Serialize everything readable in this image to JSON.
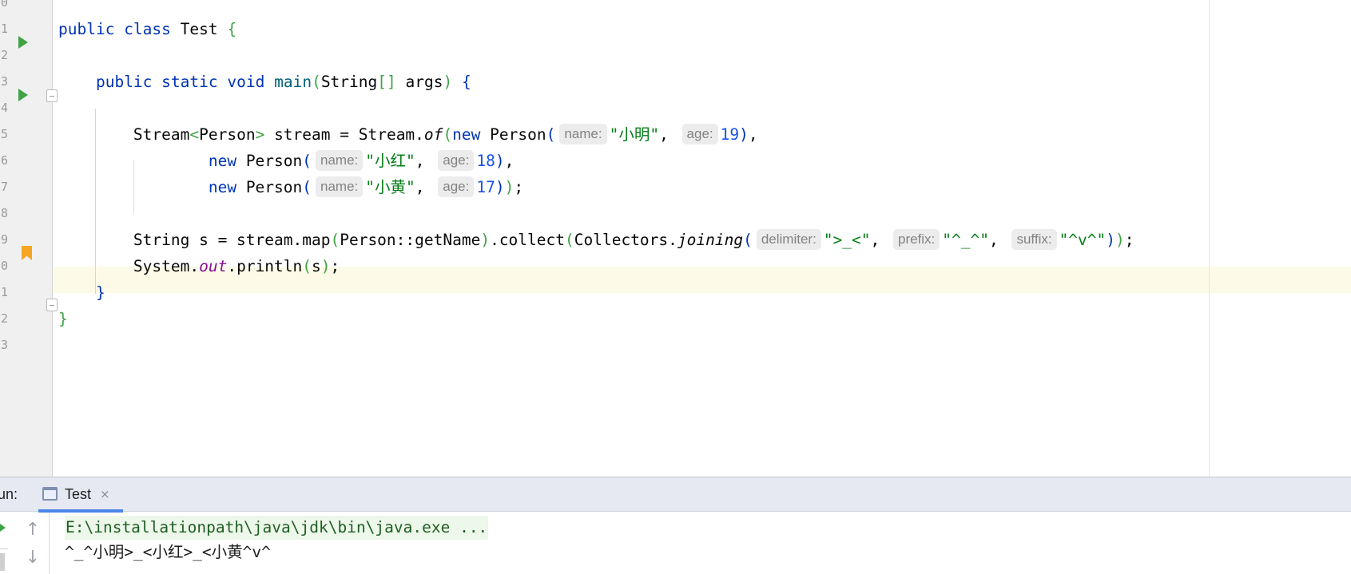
{
  "editor": {
    "file_name": "Test",
    "gutter_numbers": [
      "0",
      "1",
      "2",
      "3",
      "4",
      "5",
      "6",
      "7",
      "8",
      "9",
      "0",
      "1",
      "2",
      "3"
    ],
    "code_lines": [
      [
        {
          "t": "public",
          "c": "kw"
        },
        {
          "t": " "
        },
        {
          "t": "class",
          "c": "kw"
        },
        {
          "t": " Test "
        },
        {
          "t": "{",
          "c": "brace"
        }
      ],
      [],
      [
        {
          "t": "    "
        },
        {
          "t": "public",
          "c": "kw"
        },
        {
          "t": " "
        },
        {
          "t": "static",
          "c": "kw"
        },
        {
          "t": " "
        },
        {
          "t": "void",
          "c": "kw"
        },
        {
          "t": " "
        },
        {
          "t": "main",
          "c": "method"
        },
        {
          "t": "(",
          "c": "paren"
        },
        {
          "t": "String"
        },
        {
          "t": "[]",
          "c": "paren"
        },
        {
          "t": " args"
        },
        {
          "t": ")",
          "c": "paren"
        },
        {
          "t": " "
        },
        {
          "t": "{",
          "c": "brace2"
        }
      ],
      [],
      [
        {
          "t": "        Stream"
        },
        {
          "t": "<",
          "c": "gen"
        },
        {
          "t": "Person"
        },
        {
          "t": ">",
          "c": "gen"
        },
        {
          "t": " stream = Stream."
        },
        {
          "t": "of",
          "c": "ital"
        },
        {
          "t": "(",
          "c": "paren"
        },
        {
          "t": "new",
          "c": "kw"
        },
        {
          "t": " Person"
        },
        {
          "t": "(",
          "c": "brace2"
        },
        {
          "t": "name:",
          "c": "hint"
        },
        {
          "t": "\"小明\"",
          "c": "str"
        },
        {
          "t": ", "
        },
        {
          "t": "age:",
          "c": "hint"
        },
        {
          "t": "19",
          "c": "num"
        },
        {
          "t": ")",
          "c": "brace2"
        },
        {
          "t": ","
        }
      ],
      [
        {
          "t": "                "
        },
        {
          "t": "new",
          "c": "kw"
        },
        {
          "t": " Person"
        },
        {
          "t": "(",
          "c": "brace2"
        },
        {
          "t": "name:",
          "c": "hint"
        },
        {
          "t": "\"小红\"",
          "c": "str"
        },
        {
          "t": ", "
        },
        {
          "t": "age:",
          "c": "hint"
        },
        {
          "t": "18",
          "c": "num"
        },
        {
          "t": ")",
          "c": "brace2"
        },
        {
          "t": ","
        }
      ],
      [
        {
          "t": "                "
        },
        {
          "t": "new",
          "c": "kw"
        },
        {
          "t": " Person"
        },
        {
          "t": "(",
          "c": "brace2"
        },
        {
          "t": "name:",
          "c": "hint"
        },
        {
          "t": "\"小黄\"",
          "c": "str"
        },
        {
          "t": ", "
        },
        {
          "t": "age:",
          "c": "hint"
        },
        {
          "t": "17",
          "c": "num"
        },
        {
          "t": ")",
          "c": "brace2"
        },
        {
          "t": ")",
          "c": "paren"
        },
        {
          "t": ";"
        }
      ],
      [],
      [
        {
          "t": "        String s = stream.map"
        },
        {
          "t": "(",
          "c": "paren"
        },
        {
          "t": "Person::getName"
        },
        {
          "t": ")",
          "c": "paren"
        },
        {
          "t": ".collect"
        },
        {
          "t": "(",
          "c": "paren"
        },
        {
          "t": "Collectors."
        },
        {
          "t": "joining",
          "c": "ital"
        },
        {
          "t": "(",
          "c": "brace2"
        },
        {
          "t": "delimiter:",
          "c": "hint"
        },
        {
          "t": "\">_<\"",
          "c": "str"
        },
        {
          "t": ", "
        },
        {
          "t": "prefix:",
          "c": "hint"
        },
        {
          "t": "\"^_^\"",
          "c": "str"
        },
        {
          "t": ", "
        },
        {
          "t": "suffix:",
          "c": "hint"
        },
        {
          "t": "\"^v^\"",
          "c": "str"
        },
        {
          "t": ")",
          "c": "brace2"
        },
        {
          "t": ")",
          "c": "paren"
        },
        {
          "t": ";"
        }
      ],
      [
        {
          "t": "        System."
        },
        {
          "t": "out",
          "c": "static"
        },
        {
          "t": ".println"
        },
        {
          "t": "(",
          "c": "paren"
        },
        {
          "t": "s"
        },
        {
          "t": ")",
          "c": "paren"
        },
        {
          "t": ";"
        }
      ],
      [
        {
          "t": "    "
        },
        {
          "t": "}",
          "c": "brace2"
        }
      ],
      [
        {
          "t": "}",
          "c": "brace"
        }
      ],
      []
    ]
  },
  "run_panel": {
    "label": "un:",
    "tab_label": "Test",
    "tab_close": "×",
    "command": "E:\\installationpath\\java\\jdk\\bin\\java.exe ...",
    "output": "^_^小明>_<小红>_<小黄^v^",
    "up_arrow": "↑",
    "down_arrow": "↓"
  },
  "colors": {
    "keyword": "#0033b3",
    "string": "#067d17",
    "number": "#1750eb",
    "run_icon": "#3fa345",
    "bookmark": "#f5a623",
    "caret_row": "#fdfbe8",
    "tab_underline": "#4a86e8"
  }
}
